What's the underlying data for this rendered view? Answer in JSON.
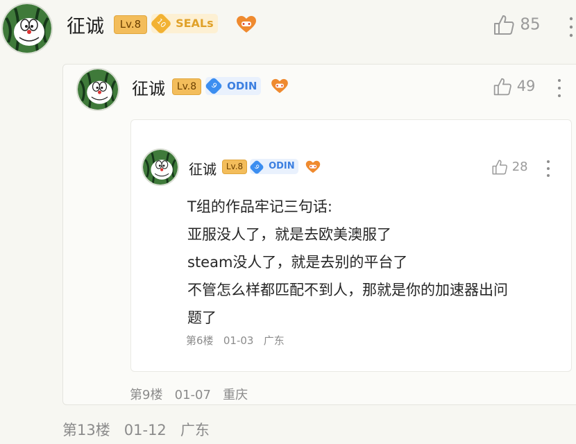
{
  "comment_l1": {
    "author": "征诚",
    "level": "Lv.8",
    "medal_num": "10",
    "medal_text": "SEALs",
    "likes": "85",
    "footer": {
      "floor": "第13楼",
      "date": "01-12",
      "location": "广东"
    }
  },
  "comment_l2": {
    "author": "征诚",
    "level": "Lv.8",
    "medal_num": "9",
    "medal_text": "ODIN",
    "likes": "49",
    "footer": {
      "floor": "第9楼",
      "date": "01-07",
      "location": "重庆"
    }
  },
  "comment_l3": {
    "author": "征诚",
    "level": "Lv.8",
    "medal_num": "9",
    "medal_text": "ODIN",
    "likes": "28",
    "content": [
      "T组的作品牢记三句话:",
      "亚服没人了，就是去欧美澳服了",
      "steam没人了，就是去别的平台了",
      "不管怎么样都匹配不到人，那就是你的加速器出问",
      "题了"
    ],
    "footer": {
      "floor": "第6楼",
      "date": "01-03",
      "location": "广东"
    }
  },
  "icons": {
    "like": "thumbs-up-icon",
    "more": "more-vertical-icon",
    "game_badge": "game-heart-icon",
    "avatar": "doraemon-watermelon-avatar"
  },
  "colors": {
    "background": "#f7f7f2",
    "level_badge": "#f3bd5b",
    "seals_medal": "#f2b233",
    "odin_medal": "#3c8ef0",
    "meta_text": "#8b8b8b"
  }
}
